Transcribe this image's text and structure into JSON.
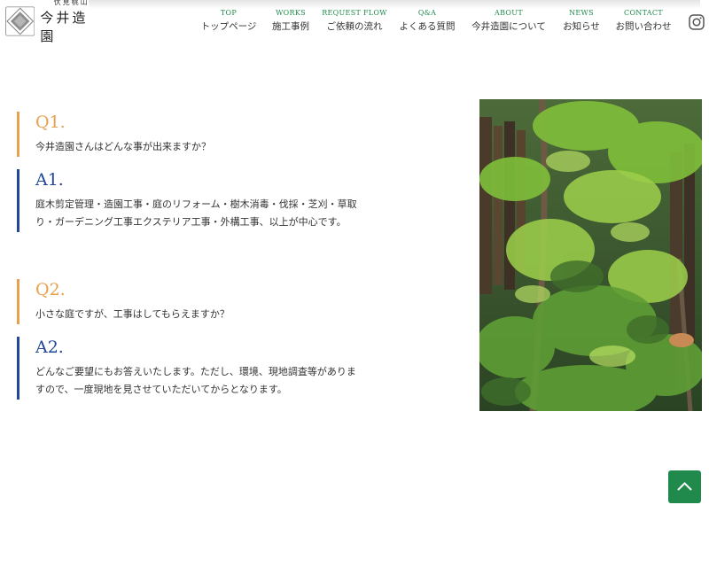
{
  "brand": {
    "sub": "伏見桃山",
    "name": "今井造園"
  },
  "nav": [
    {
      "en": "TOP",
      "jp": "トップページ"
    },
    {
      "en": "WORKS",
      "jp": "施工事例"
    },
    {
      "en": "REQUEST FLOW",
      "jp": "ご依頼の流れ"
    },
    {
      "en": "Q&A",
      "jp": "よくある質問"
    },
    {
      "en": "ABOUT",
      "jp": "今井造園について"
    },
    {
      "en": "NEWS",
      "jp": "お知らせ"
    },
    {
      "en": "CONTACT",
      "jp": "お問い合わせ"
    }
  ],
  "social": {
    "icon": "instagram-icon"
  },
  "faq": [
    {
      "q_label": "Q1.",
      "question": "今井造園さんはどんな事が出来ますか？",
      "a_label": "A1.",
      "answer": [
        "庭木剪定管理・造園工事・庭のリフォーム・樹木消毒・伐採・芝刈・草取",
        "り・ガーデニング工事エクステリア工事・外構工事、以上が中心です。"
      ]
    },
    {
      "q_label": "Q2.",
      "question": "小さな庭ですが、工事はしてもらえますか？",
      "a_label": "A2.",
      "answer": [
        "どんなご要望にもお答えいたします。ただし、環境、現地調査等がありま",
        "すので、一度現地を見させていただいてからとなります。"
      ]
    }
  ],
  "colors": {
    "accent_green": "#1f8a4c",
    "question_orange": "#e9a04d",
    "answer_blue": "#23489a"
  },
  "back_to_top": {
    "icon": "chevron-up-icon"
  }
}
